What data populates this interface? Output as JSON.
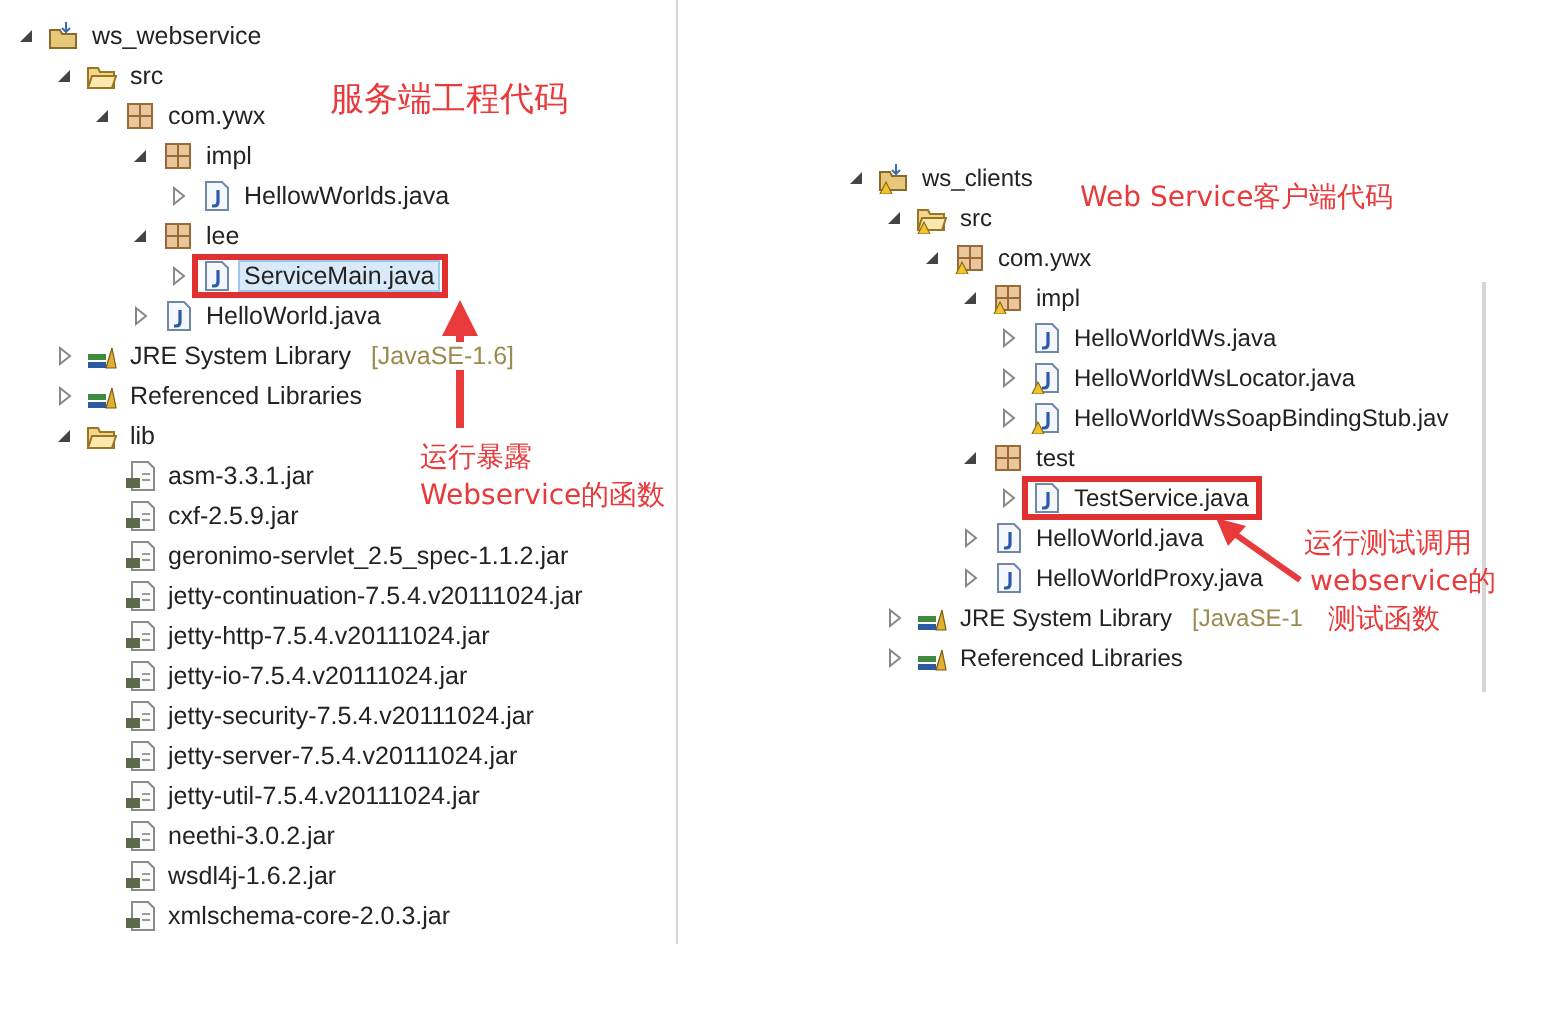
{
  "left_tree": {
    "nodes": [
      {
        "label": "ws_webservice",
        "kind": "project",
        "expanded": true,
        "children": [
          {
            "label": "src",
            "kind": "folder",
            "expanded": true,
            "children": [
              {
                "label": "com.ywx",
                "kind": "package",
                "expanded": true,
                "children": [
                  {
                    "label": "impl",
                    "kind": "package",
                    "expanded": true,
                    "children": [
                      {
                        "label": "HellowWorlds.java",
                        "kind": "java",
                        "expanded": false
                      }
                    ]
                  },
                  {
                    "label": "lee",
                    "kind": "package",
                    "expanded": true,
                    "children": [
                      {
                        "label": "ServiceMain.java",
                        "kind": "java",
                        "expanded": false,
                        "selected": true,
                        "highlighted": true
                      }
                    ]
                  },
                  {
                    "label": "HelloWorld.java",
                    "kind": "java",
                    "expanded": false
                  }
                ]
              }
            ]
          },
          {
            "label": "JRE System Library",
            "kind": "library",
            "expanded": false,
            "version": "[JavaSE-1.6]"
          },
          {
            "label": "Referenced Libraries",
            "kind": "library",
            "expanded": false
          },
          {
            "label": "lib",
            "kind": "folder",
            "expanded": true,
            "children": [
              {
                "label": "asm-3.3.1.jar",
                "kind": "jar"
              },
              {
                "label": "cxf-2.5.9.jar",
                "kind": "jar"
              },
              {
                "label": "geronimo-servlet_2.5_spec-1.1.2.jar",
                "kind": "jar"
              },
              {
                "label": "jetty-continuation-7.5.4.v20111024.jar",
                "kind": "jar"
              },
              {
                "label": "jetty-http-7.5.4.v20111024.jar",
                "kind": "jar"
              },
              {
                "label": "jetty-io-7.5.4.v20111024.jar",
                "kind": "jar"
              },
              {
                "label": "jetty-security-7.5.4.v20111024.jar",
                "kind": "jar"
              },
              {
                "label": "jetty-server-7.5.4.v20111024.jar",
                "kind": "jar"
              },
              {
                "label": "jetty-util-7.5.4.v20111024.jar",
                "kind": "jar"
              },
              {
                "label": "neethi-3.0.2.jar",
                "kind": "jar"
              },
              {
                "label": "wsdl4j-1.6.2.jar",
                "kind": "jar"
              },
              {
                "label": "xmlschema-core-2.0.3.jar",
                "kind": "jar"
              }
            ]
          }
        ]
      }
    ]
  },
  "left_notes": [
    "服务端工程代码",
    "运行暴露",
    "Webservice的函数"
  ],
  "right_tree": {
    "nodes": [
      {
        "label": "ws_clients",
        "kind": "project",
        "expanded": true,
        "warning": true,
        "children": [
          {
            "label": "src",
            "kind": "folder",
            "expanded": true,
            "warning": true,
            "children": [
              {
                "label": "com.ywx",
                "kind": "package",
                "expanded": true,
                "warning": true,
                "children": [
                  {
                    "label": "impl",
                    "kind": "package",
                    "expanded": true,
                    "warning": true,
                    "children": [
                      {
                        "label": "HelloWorldWs.java",
                        "kind": "java",
                        "expanded": false
                      },
                      {
                        "label": "HelloWorldWsLocator.java",
                        "kind": "java",
                        "expanded": false,
                        "warning": true
                      },
                      {
                        "label": "HelloWorldWsSoapBindingStub.jav",
                        "kind": "java",
                        "expanded": false,
                        "warning": true
                      }
                    ]
                  },
                  {
                    "label": "test",
                    "kind": "package",
                    "expanded": true,
                    "children": [
                      {
                        "label": "TestService.java",
                        "kind": "java",
                        "expanded": false,
                        "highlighted": true
                      }
                    ]
                  },
                  {
                    "label": "HelloWorld.java",
                    "kind": "java",
                    "expanded": false
                  },
                  {
                    "label": "HelloWorldProxy.java",
                    "kind": "java",
                    "expanded": false
                  }
                ]
              }
            ]
          },
          {
            "label": "JRE System Library",
            "kind": "library",
            "expanded": false,
            "version": "[JavaSE-1"
          },
          {
            "label": "Referenced Libraries",
            "kind": "library",
            "expanded": false
          }
        ]
      }
    ]
  },
  "right_notes": [
    "Web Service客户端代码",
    "运行测试调用",
    "webservice的",
    "测试函数"
  ]
}
